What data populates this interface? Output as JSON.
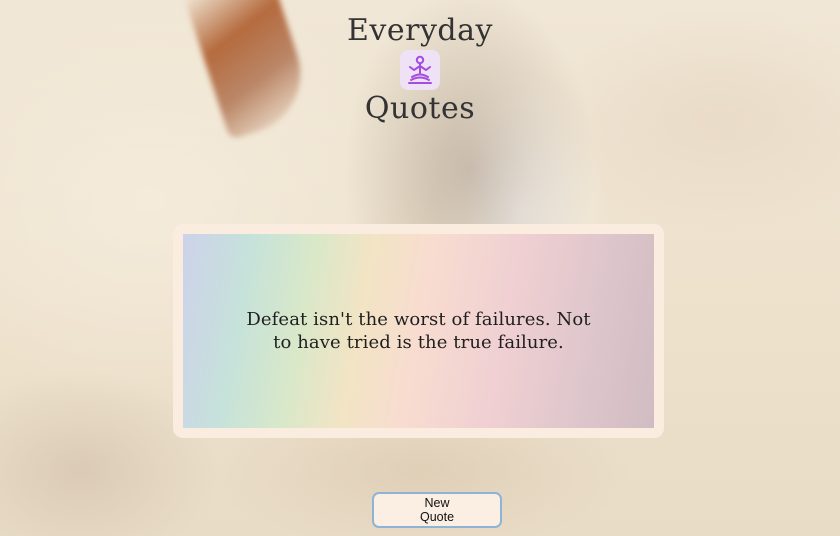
{
  "header": {
    "title_top": "Everyday",
    "title_bottom": "Quotes",
    "logo_icon": "meditation-person-icon"
  },
  "quote": {
    "text": "Defeat isn't the worst of failures. Not to have tried is the true failure."
  },
  "actions": {
    "new_quote_label": "New Quote"
  },
  "colors": {
    "card_border": "#fbece0",
    "logo_bg": "#efe2f7",
    "logo_figure": "#a44de0",
    "button_bg": "#fbeee3",
    "button_border": "#8fb3d6"
  }
}
